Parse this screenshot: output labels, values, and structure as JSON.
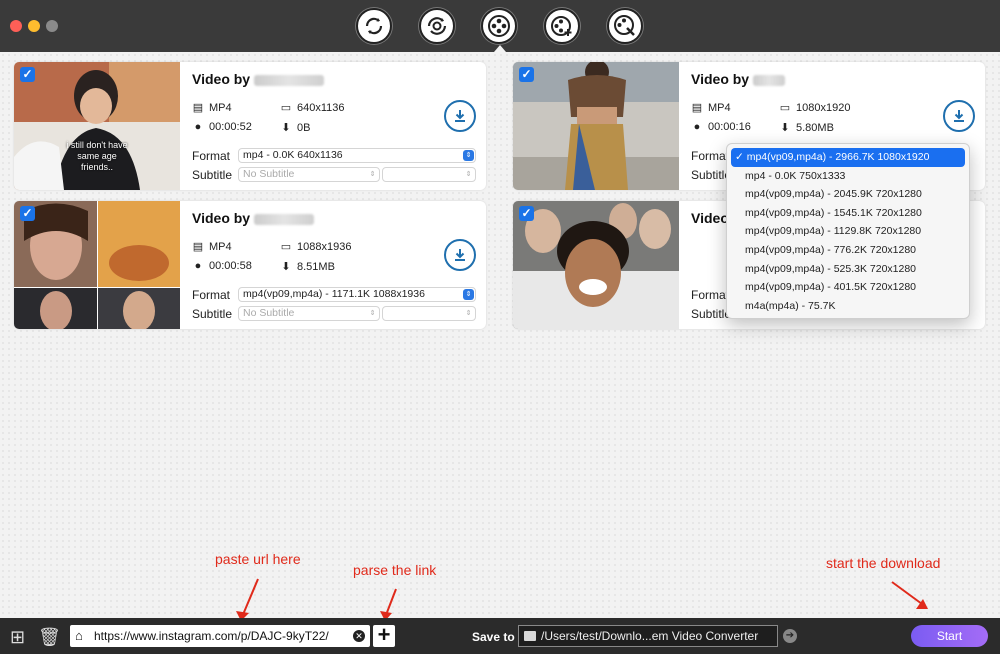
{
  "toolbar": {
    "tools": [
      "convert-icon",
      "refresh-convert-icon",
      "film-reel-icon",
      "film-add-icon",
      "film-tools-icon"
    ]
  },
  "videos": [
    {
      "title": "Video by",
      "format_type": "MP4",
      "resolution": "640x1136",
      "duration": "00:00:52",
      "size": "0B",
      "format_label": "Format",
      "format_value": "mp4 - 0.0K 640x1136",
      "subtitle_label": "Subtitle",
      "subtitle_value": "No Subtitle",
      "thumb_caption": "i still don't have\nsame age friends.."
    },
    {
      "title": "Video by",
      "format_type": "MP4",
      "resolution": "1080x1920",
      "duration": "00:00:16",
      "size": "5.80MB",
      "format_label": "Format",
      "subtitle_label": "Subtitle"
    },
    {
      "title": "Video by",
      "format_type": "MP4",
      "resolution": "1088x1936",
      "duration": "00:00:58",
      "size": "8.51MB",
      "format_label": "Format",
      "format_value": "mp4(vp09,mp4a) - 1171.1K 1088x1936",
      "subtitle_label": "Subtitle",
      "subtitle_value": "No Subtitle"
    },
    {
      "title": "Video by",
      "format_label": "Format",
      "subtitle_label": "Subtitle"
    }
  ],
  "dropdown": {
    "options": [
      "mp4(vp09,mp4a) - 2966.7K 1080x1920",
      "mp4 - 0.0K 750x1333",
      "mp4(vp09,mp4a) - 2045.9K 720x1280",
      "mp4(vp09,mp4a) - 1545.1K 720x1280",
      "mp4(vp09,mp4a) - 1129.8K 720x1280",
      "mp4(vp09,mp4a) - 776.2K 720x1280",
      "mp4(vp09,mp4a) - 525.3K 720x1280",
      "mp4(vp09,mp4a) - 401.5K 720x1280",
      "m4a(mp4a) - 75.7K"
    ],
    "selected_index": 0
  },
  "bottombar": {
    "url": "https://www.instagram.com/p/DAJC-9kyT22/",
    "save_to_label": "Save to",
    "save_path": "/Users/test/Downlo...em Video Converter",
    "start_label": "Start"
  },
  "annotations": {
    "paste": "paste url here",
    "parse": "parse the link",
    "start": "start the download"
  },
  "colors": {
    "accent": "#1a6ff0",
    "download_ring": "#1f6fae",
    "annotation": "#e02a1b",
    "start_gradient": [
      "#7b5cf2",
      "#a46cf6"
    ]
  }
}
